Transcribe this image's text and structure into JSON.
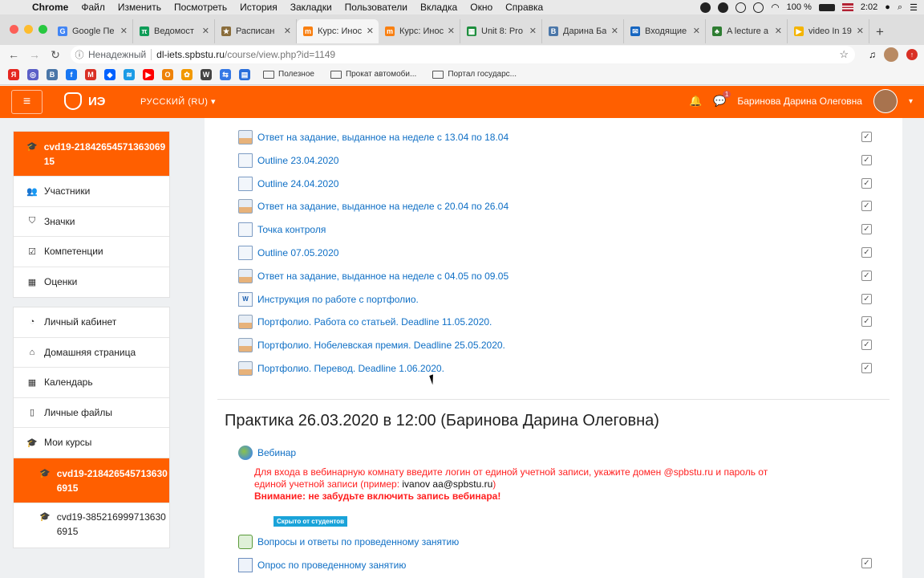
{
  "mac_menu": {
    "app": "Chrome",
    "items": [
      "Файл",
      "Изменить",
      "Посмотреть",
      "История",
      "Закладки",
      "Пользователи",
      "Вкладка",
      "Окно",
      "Справка"
    ],
    "battery": "100 %",
    "time": "2:02"
  },
  "tabs": [
    {
      "label": "Google Пе",
      "icon": "google-docs-icon",
      "color": "#4285f4",
      "glyph": "G"
    },
    {
      "label": "Ведомост",
      "icon": "sheet-icon",
      "color": "#0f9d58",
      "glyph": "π"
    },
    {
      "label": "Расписан",
      "icon": "star-icon",
      "color": "#8a6d3b",
      "glyph": "★"
    },
    {
      "label": "Курс: Инос",
      "icon": "moodle-icon",
      "color": "#f98012",
      "glyph": "m",
      "active": true
    },
    {
      "label": "Курс: Инос",
      "icon": "moodle-icon",
      "color": "#f98012",
      "glyph": "m"
    },
    {
      "label": "Unit 8: Pro",
      "icon": "classroom-icon",
      "color": "#1e8e3e",
      "glyph": "▦"
    },
    {
      "label": "Дарина Ба",
      "icon": "vk-icon",
      "color": "#4a76a8",
      "glyph": "B"
    },
    {
      "label": "Входящие",
      "icon": "mail-icon",
      "color": "#1565c0",
      "glyph": "✉"
    },
    {
      "label": "A lecture a",
      "icon": "clover-icon",
      "color": "#2e7d32",
      "glyph": "♣"
    },
    {
      "label": "video In 19",
      "icon": "play-icon",
      "color": "#f4b400",
      "glyph": "▶"
    }
  ],
  "omnibox": {
    "insecure_label": "Ненадежный",
    "host": "dl-iets.spbstu.ru",
    "path": "/course/view.php?id=1149"
  },
  "bookmarks": {
    "icons": [
      {
        "name": "yandex-icon",
        "color": "#e52620",
        "glyph": "Я"
      },
      {
        "name": "app-icon",
        "color": "#5b5fc7",
        "glyph": "◎"
      },
      {
        "name": "vk-icon",
        "color": "#4a76a8",
        "glyph": "B"
      },
      {
        "name": "facebook-icon",
        "color": "#1877f2",
        "glyph": "f"
      },
      {
        "name": "gmail-icon",
        "color": "#d93025",
        "glyph": "M"
      },
      {
        "name": "dropbox-icon",
        "color": "#0061ff",
        "glyph": "◆"
      },
      {
        "name": "wifi-app-icon",
        "color": "#1a9be6",
        "glyph": "≋"
      },
      {
        "name": "youtube-icon",
        "color": "#ff0000",
        "glyph": "▶"
      },
      {
        "name": "ok-icon",
        "color": "#ee8208",
        "glyph": "О"
      },
      {
        "name": "chrome-web-icon",
        "color": "#f29900",
        "glyph": "✿"
      },
      {
        "name": "wikipedia-icon",
        "color": "#444444",
        "glyph": "W"
      },
      {
        "name": "translate-icon",
        "color": "#3578e5",
        "glyph": "⇆"
      },
      {
        "name": "docs-icon",
        "color": "#2a6fdb",
        "glyph": "▤"
      }
    ],
    "folders": [
      {
        "label": "Полезное"
      },
      {
        "label": "Прокат автомоби..."
      },
      {
        "label": "Портал государс..."
      }
    ]
  },
  "navbar": {
    "brand": "ИЭ",
    "language": "РУССКИЙ (RU)",
    "message_count": "1",
    "user_name": "Баринова Дарина Олеговна"
  },
  "drawer": {
    "course": "cvd19-2184265457136306915",
    "course_items": [
      {
        "label": "Участники",
        "icon": "users-icon",
        "glyph": "👥"
      },
      {
        "label": "Значки",
        "icon": "shield-icon",
        "glyph": "⛉"
      },
      {
        "label": "Компетенции",
        "icon": "checkbox-icon",
        "glyph": "☑"
      },
      {
        "label": "Оценки",
        "icon": "table-icon",
        "glyph": "▦"
      }
    ],
    "site_items": [
      {
        "label": "Личный кабинет",
        "icon": "dashboard-icon",
        "glyph": "◔"
      },
      {
        "label": "Домашняя страница",
        "icon": "home-icon",
        "glyph": "⌂"
      },
      {
        "label": "Календарь",
        "icon": "calendar-icon",
        "glyph": "▦"
      },
      {
        "label": "Личные файлы",
        "icon": "file-icon",
        "glyph": "▯"
      },
      {
        "label": "Мои курсы",
        "icon": "graduation-cap-icon",
        "glyph": "🎓"
      }
    ],
    "my_courses": [
      {
        "label": "cvd19-2184265457136306915",
        "active": true
      },
      {
        "label": "cvd19-3852169997136306915",
        "active": false
      }
    ]
  },
  "activities": [
    {
      "label": "Ответ на задание, выданное на неделе с 13.04 по 18.04",
      "type": "assignment"
    },
    {
      "label": "Outline 23.04.2020",
      "type": "file"
    },
    {
      "label": "Outline 24.04.2020",
      "type": "file"
    },
    {
      "label": "Ответ на задание, выданное на неделе с 20.04 по 26.04",
      "type": "assignment"
    },
    {
      "label": "Точка контроля",
      "type": "file"
    },
    {
      "label": "Outline 07.05.2020",
      "type": "file"
    },
    {
      "label": "Ответ на задание, выданное на неделе с 04.05 по 09.05",
      "type": "assignment"
    },
    {
      "label": "Инструкция по работе с портфолио.",
      "type": "word"
    },
    {
      "label": "Портфолио. Работа со статьей. Deadline 11.05.2020.",
      "type": "assignment"
    },
    {
      "label": "Портфолио. Нобелевская премия. Deadline 25.05.2020.",
      "type": "assignment"
    },
    {
      "label": "Портфолио. Перевод. Deadline 1.06.2020.",
      "type": "assignment"
    }
  ],
  "section": {
    "title": "Практика 26.03.2020 в 12:00 (Баринова Дарина Олеговна)",
    "webinar_label": "Вебинар",
    "notice_line1": "Для входа в вебинарную комнату введите логин от единой учетной записи, укажите домен @spbstu.ru и пароль от",
    "notice_line2_prefix": "единой учетной записи (пример: ",
    "notice_example": "ivanov  aa@spbstu.ru",
    "notice_line2_suffix": ")",
    "notice_bold": "Внимание: не забудьте включить запись вебинара!",
    "hidden_badge": "Скрыто от студентов",
    "forum_label": "Вопросы и ответы по проведенному занятию",
    "quiz_label": "Опрос по проведенному занятию"
  }
}
